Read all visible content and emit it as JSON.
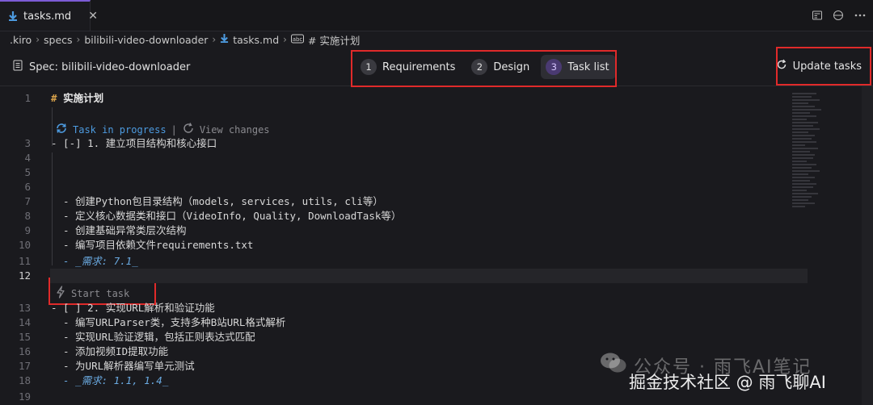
{
  "tab": {
    "label": "tasks.md",
    "close": "✕"
  },
  "breadcrumb": [
    ".kiro",
    "specs",
    "bilibili-video-downloader",
    "tasks.md",
    "# 实施计划"
  ],
  "breadcrumb_sep": "›",
  "spec": {
    "title": "Spec: bilibili-video-downloader"
  },
  "steps": [
    {
      "num": "1",
      "label": "Requirements"
    },
    {
      "num": "2",
      "label": "Design"
    },
    {
      "num": "3",
      "label": "Task list"
    }
  ],
  "update_label": "Update tasks",
  "codelens": {
    "progress": "Task in progress",
    "sep": "|",
    "view": "View changes",
    "start": "Start task"
  },
  "lines": [
    {
      "n": "1",
      "text": "实施计划"
    },
    {
      "n": "3",
      "text": "- [-] 1. 建立项目结构和核心接口"
    },
    {
      "n": "4",
      "text": ""
    },
    {
      "n": "5",
      "text": ""
    },
    {
      "n": "6",
      "text": ""
    },
    {
      "n": "7",
      "text": "- 创建Python包目录结构（models, services, utils, cli等）"
    },
    {
      "n": "8",
      "text": "- 定义核心数据类和接口（VideoInfo, Quality, DownloadTask等）"
    },
    {
      "n": "9",
      "text": "- 创建基础异常类层次结构"
    },
    {
      "n": "10",
      "text": "- 编写项目依赖文件requirements.txt"
    },
    {
      "n": "11",
      "text": "- _需求: 7.1_"
    },
    {
      "n": "12",
      "text": ""
    },
    {
      "n": "13",
      "text": "- [ ] 2. 实现URL解析和验证功能"
    },
    {
      "n": "14",
      "text": "- 编写URLParser类，支持多种B站URL格式解析"
    },
    {
      "n": "15",
      "text": "- 实现URL验证逻辑，包括正则表达式匹配"
    },
    {
      "n": "16",
      "text": "- 添加视频ID提取功能"
    },
    {
      "n": "17",
      "text": "- 为URL解析器编写单元测试"
    },
    {
      "n": "18",
      "text": "- _需求: 1.1, 1.4_"
    },
    {
      "n": "19",
      "text": ""
    }
  ],
  "heading_hash": "#",
  "watermark": {
    "line1": "公众号 · 雨飞AI笔记",
    "line2": "掘金技术社区 @ 雨飞聊AI"
  },
  "colors": {
    "accent": "#7c5cd6",
    "highlight": "#e02a2a",
    "link": "#4d9be0"
  }
}
